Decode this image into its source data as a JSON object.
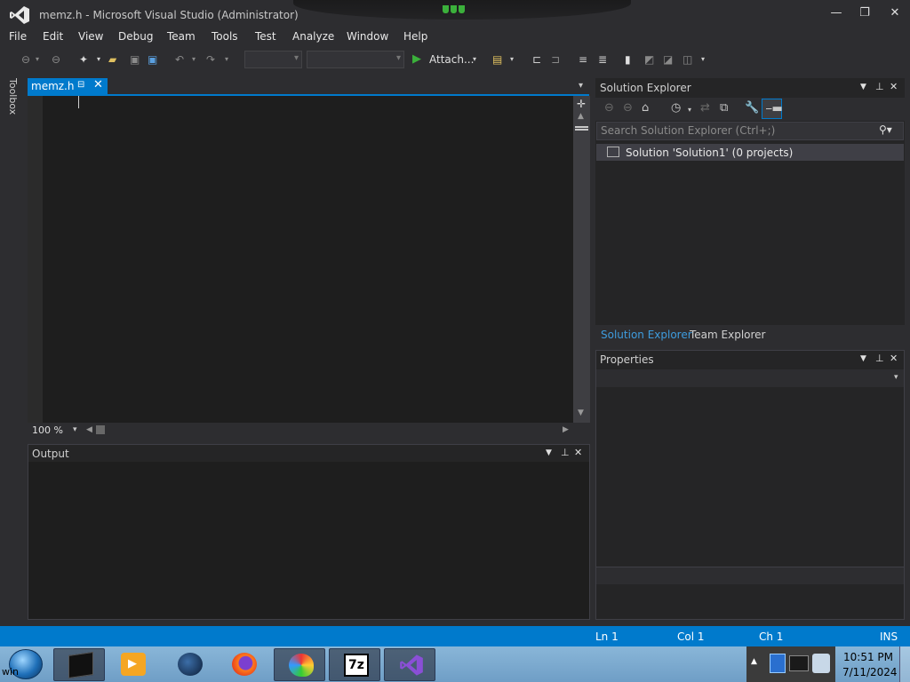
{
  "window": {
    "title": "memz.h - Microsoft Visual Studio (Administrator)",
    "minimize_glyph": "—",
    "restore_glyph": "❐",
    "close_glyph": "✕"
  },
  "menu": [
    "File",
    "Edit",
    "View",
    "Debug",
    "Team",
    "Tools",
    "Test",
    "Analyze",
    "Window",
    "Help"
  ],
  "toolbar": {
    "attach_label": "Attach...",
    "icons": [
      "back-icon",
      "forward-icon",
      "new-project-icon",
      "open-icon",
      "save-icon",
      "save-all-icon",
      "undo-icon",
      "redo-icon",
      "start-icon",
      "find-icon",
      "comment-icon",
      "bookmark-icon"
    ]
  },
  "toolbox": {
    "label": "Toolbox"
  },
  "editor": {
    "tab_label": "memz.h",
    "tab_pin_glyph": "⊟",
    "tab_close_glyph": "✕",
    "zoom": "100 %"
  },
  "output": {
    "title": "Output"
  },
  "solution_explorer": {
    "title": "Solution Explorer",
    "search_placeholder": "Search Solution Explorer (Ctrl+;)",
    "tree_item": "Solution 'Solution1' (0 projects)",
    "tabs": [
      "Solution Explorer",
      "Team Explorer"
    ]
  },
  "properties": {
    "title": "Properties"
  },
  "statusbar": {
    "ln": "Ln 1",
    "col": "Col 1",
    "ch": "Ch 1",
    "mode": "INS"
  },
  "taskbar": {
    "start_text": "win",
    "time": "10:51 PM",
    "date": "7/11/2024",
    "apps": [
      "terminal-app",
      "media-player-app",
      "globe-app",
      "firefox-app",
      "paint-app",
      "7zip-app",
      "visual-studio-app"
    ],
    "sevenzip_label": "7z"
  },
  "colors": {
    "accent": "#007acc",
    "background": "#2d2d30",
    "editor": "#1e1e1e"
  }
}
